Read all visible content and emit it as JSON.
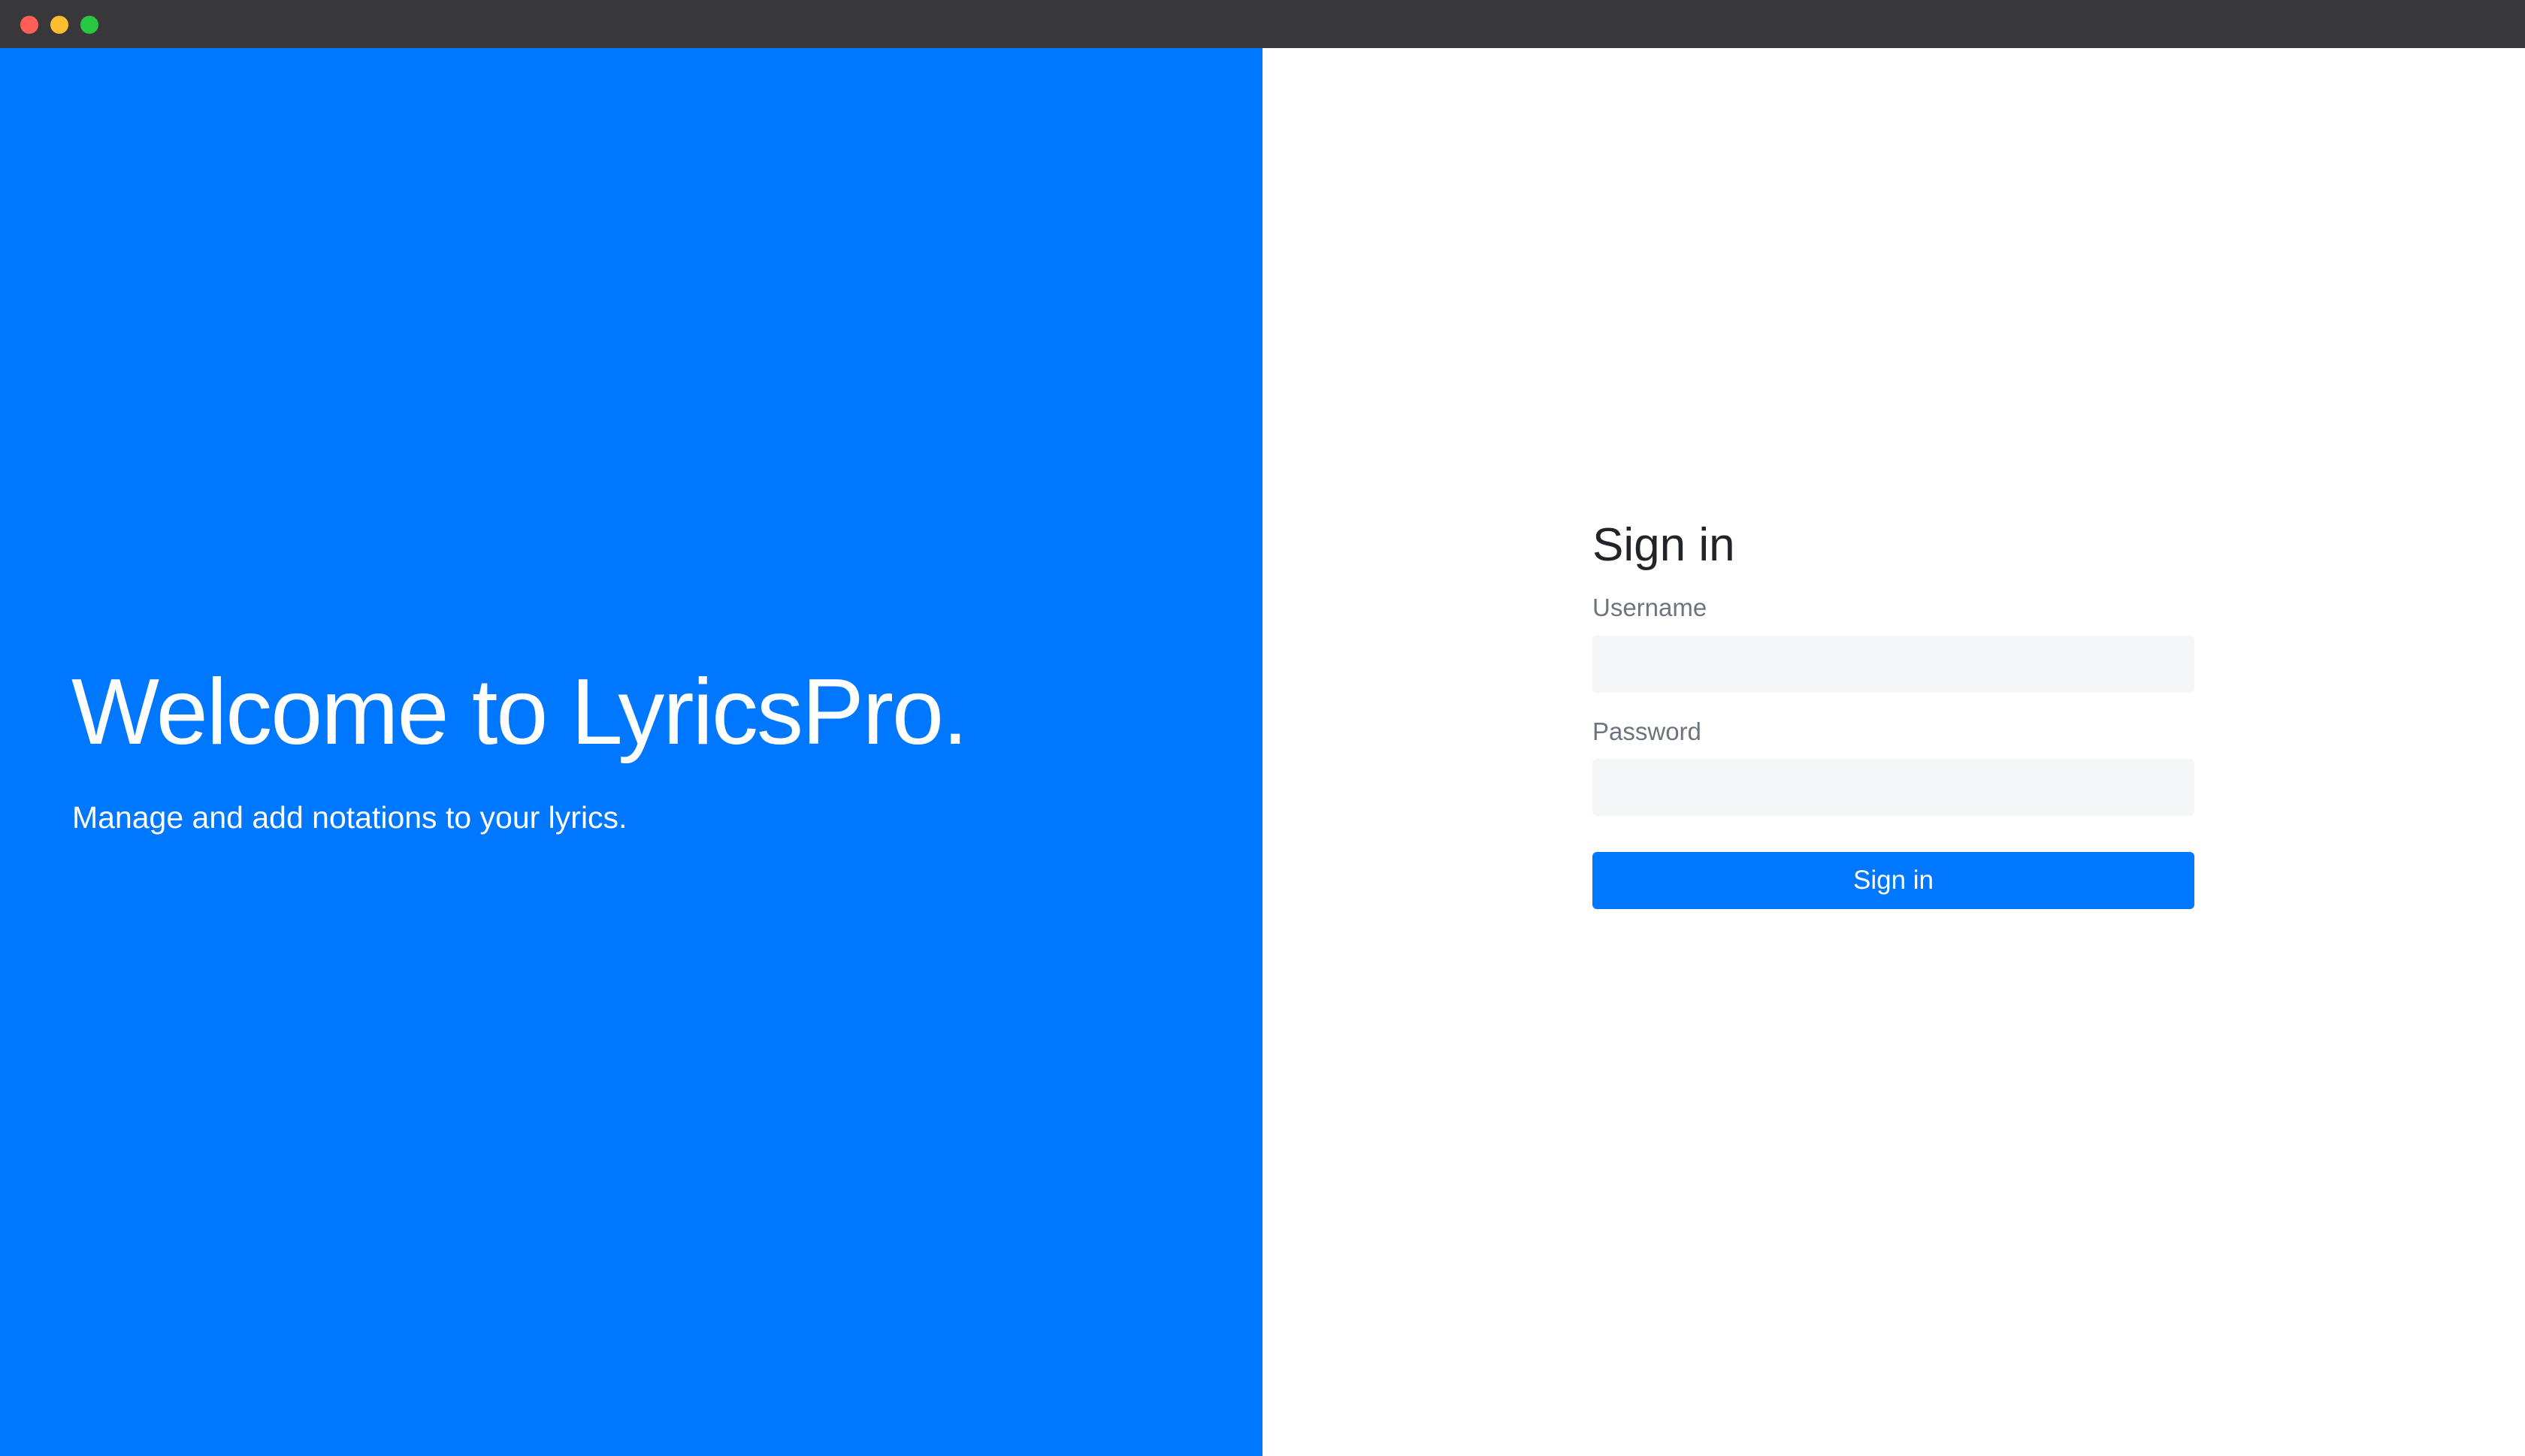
{
  "window": {
    "controls": [
      {
        "name": "close",
        "color": "#ff5f57"
      },
      {
        "name": "minimize",
        "color": "#febc2e"
      },
      {
        "name": "zoom",
        "color": "#28c840"
      }
    ]
  },
  "theme": {
    "primary": "#0077ff",
    "hero_background": "#0077ff"
  },
  "hero": {
    "title": "Welcome to LyricsPro.",
    "subtitle": "Manage and add notations to your lyrics."
  },
  "signin": {
    "title": "Sign in",
    "username": {
      "label": "Username",
      "value": "",
      "placeholder": ""
    },
    "password": {
      "label": "Password",
      "value": "",
      "placeholder": ""
    },
    "submit_label": "Sign in"
  }
}
